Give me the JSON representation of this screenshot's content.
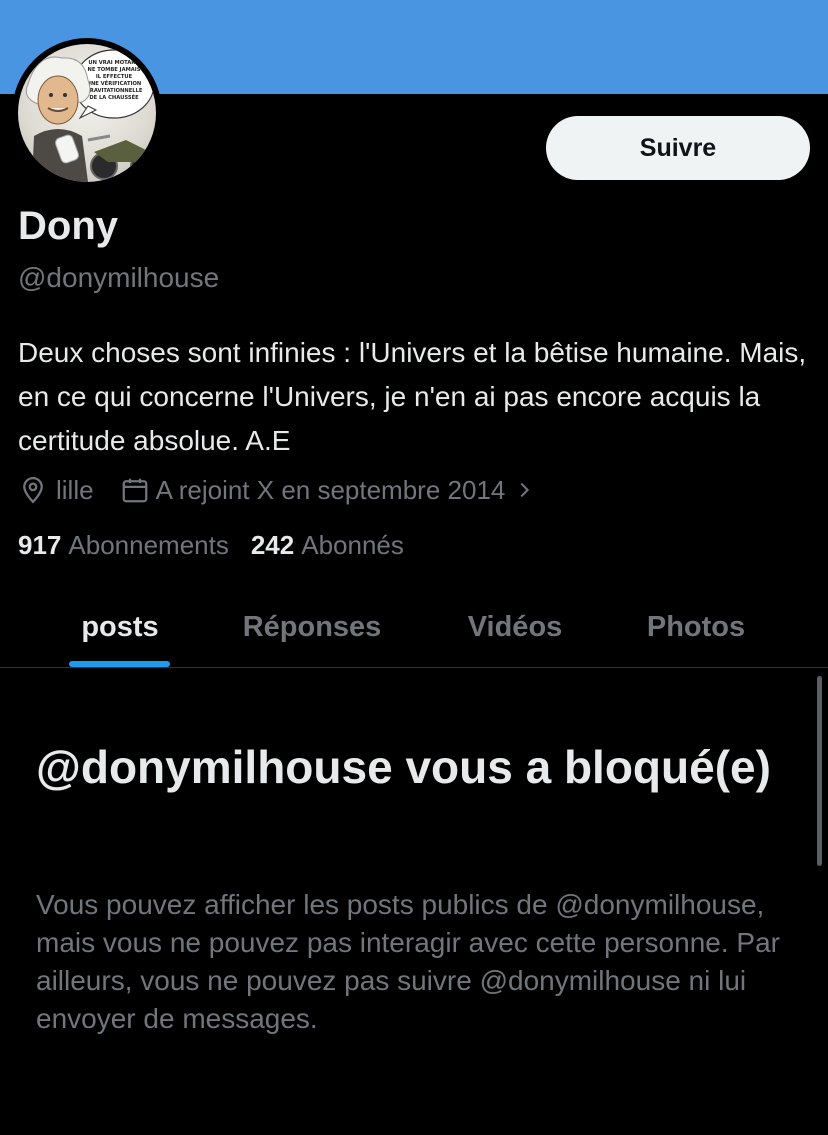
{
  "profile": {
    "name": "Dony",
    "handle": "@donymilhouse",
    "bio": "Deux choses sont infinies : l'Univers et la bêtise humaine. Mais, en ce qui concerne l'Univers, je n'en ai pas encore acquis la certitude absolue. A.E",
    "avatar_caption": [
      "UN VRAI MOTARD",
      "NE TOMBE JAMAIS",
      "IL EFFECTUE",
      "UNE VÉRIFICATION",
      "GRAVITATIONNELLE",
      "DE LA CHAUSSÉE"
    ],
    "location": "lille",
    "joined": "A rejoint X en septembre 2014"
  },
  "actions": {
    "follow_label": "Suivre"
  },
  "stats": {
    "following_count": "917",
    "following_label": "Abonnements",
    "followers_count": "242",
    "followers_label": "Abonnés"
  },
  "tabs": [
    {
      "label": "posts",
      "active": true
    },
    {
      "label": "Réponses",
      "active": false
    },
    {
      "label": "Vidéos",
      "active": false
    },
    {
      "label": "Photos",
      "active": false
    }
  ],
  "blocked": {
    "title": "@donymilhouse vous a bloqué(e)",
    "description": "Vous pouvez afficher les posts publics de @donymilhouse, mais vous ne pouvez pas interagir avec cette personne. Par ailleurs, vous ne pouvez pas suivre @donymilhouse ni lui envoyer de messages."
  },
  "colors": {
    "banner": "#4a95e1",
    "background": "#000000",
    "text_primary": "#e7e9ea",
    "text_secondary": "#71767b",
    "accent": "#1d9bf0",
    "follow_button": "#eff3f4"
  },
  "icons": {
    "location": "location-pin-icon",
    "calendar": "calendar-icon",
    "chevron": "chevron-right-icon"
  }
}
